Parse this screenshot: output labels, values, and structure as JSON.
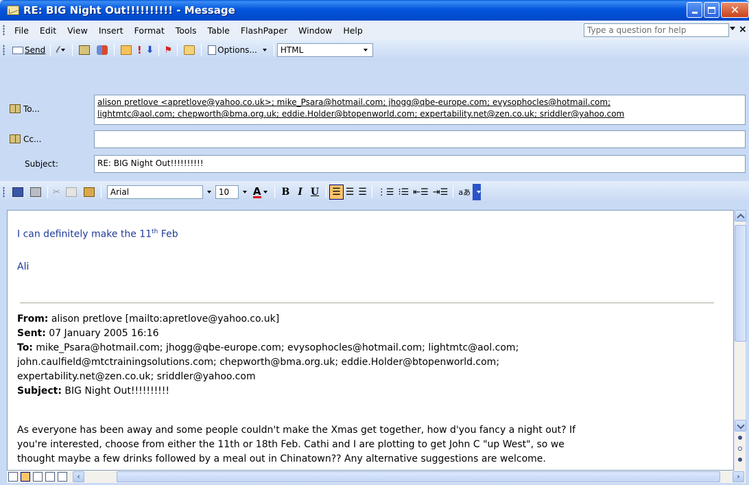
{
  "window": {
    "title": "RE: BIG Night Out!!!!!!!!!! - Message"
  },
  "menubar": {
    "items": [
      "File",
      "Edit",
      "View",
      "Insert",
      "Format",
      "Tools",
      "Table",
      "FlashPaper",
      "Window",
      "Help"
    ],
    "help_placeholder": "Type a question for help"
  },
  "toolbar": {
    "send_label": "Send",
    "options_label": "Options...",
    "format_value": "HTML"
  },
  "header": {
    "to_label": "To...",
    "cc_label": "Cc...",
    "subject_label": "Subject:",
    "to_line1": "alison pretlove <apretlove@yahoo.co.uk>; mike_Psara@hotmail.com; jhogg@qbe-europe.com; evysophocles@hotmail.com;",
    "to_line2": "lightmtc@aol.com; chepworth@bma.org.uk; eddie.Holder@btopenworld.com; expertability.net@zen.co.uk; sriddler@yahoo.com",
    "cc_value": "",
    "subject_value": "RE: BIG Night Out!!!!!!!!!!"
  },
  "format_toolbar": {
    "font": "Arial",
    "size": "10"
  },
  "body": {
    "reply_line1": "I can definitely make the 11",
    "reply_sup": "th",
    "reply_line1_end": " Feb",
    "reply_sign": "Ali",
    "from_label": "From:",
    "from_value": " alison pretlove [mailto:apretlove@yahoo.co.uk]",
    "sent_label": "Sent:",
    "sent_value": " 07 January 2005 16:16",
    "to_label": "To:",
    "to_value1": " mike_Psara@hotmail.com; jhogg@qbe-europe.com; evysophocles@hotmail.com; lightmtc@aol.com;",
    "to_value2": "john.caulfield@mtctrainingsolutions.com; chepworth@bma.org.uk; eddie.Holder@btopenworld.com;",
    "to_value3": "expertability.net@zen.co.uk; sriddler@yahoo.com",
    "subject_label": "Subject:",
    "subject_value": " BIG Night Out!!!!!!!!!!",
    "para1": "As everyone has been away and some people couldn't make the Xmas get together, how d'you fancy a night out?  If",
    "para2": "you're interested, choose from either the 11th or 18th Feb.  Cathi and I are plotting to get John C \"up West\", so we",
    "para3": "thought maybe a few drinks followed by a meal out in Chinatown??  Any alternative suggestions are welcome."
  },
  "colors": {
    "titlebar": "#0455dc",
    "reply_text": "#1f3a99",
    "active_button": "#ffc46a"
  }
}
